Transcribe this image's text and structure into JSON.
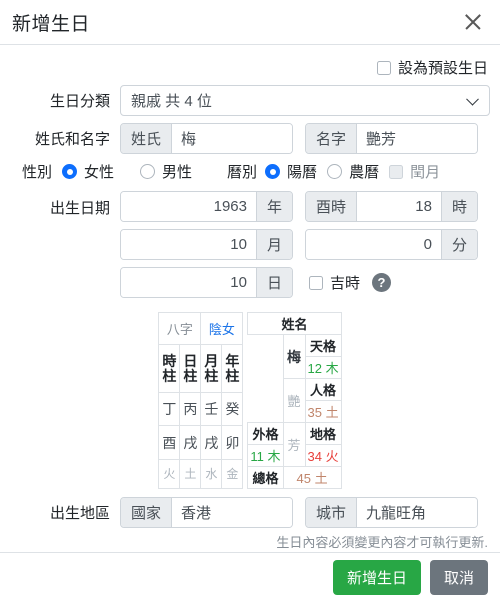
{
  "header": {
    "title": "新增生日",
    "close_icon": "close-icon"
  },
  "form": {
    "default_birthday_checkbox": {
      "label": "設為預設生日",
      "checked": false
    },
    "category": {
      "label": "生日分類",
      "value": "親戚 共 4 位",
      "chevron_icon": "chevron-down-icon"
    },
    "name": {
      "label": "姓氏和名字",
      "surname_addon": "姓氏",
      "surname_value": "梅",
      "given_addon": "名字",
      "given_value": "艷芳"
    },
    "gender": {
      "label": "性別",
      "options": [
        {
          "label": "女性",
          "selected": true
        },
        {
          "label": "男性",
          "selected": false
        }
      ]
    },
    "calendar": {
      "label": "曆別",
      "options": [
        {
          "label": "陽曆",
          "selected": true
        },
        {
          "label": "農曆",
          "selected": false
        }
      ],
      "leap_month": {
        "label": "閏月",
        "checked": false,
        "disabled": true
      }
    },
    "birthdate": {
      "label": "出生日期",
      "year": {
        "value": "1963",
        "suffix": "年"
      },
      "month": {
        "value": "10",
        "suffix": "月"
      },
      "day": {
        "value": "10",
        "suffix": "日"
      },
      "hour": {
        "prefix": "酉時",
        "value": "18",
        "suffix": "時"
      },
      "minute": {
        "value": "0",
        "suffix": "分"
      },
      "auspicious": {
        "label": "吉時",
        "checked": false
      },
      "help_icon": "question-mark-icon"
    },
    "region": {
      "label": "出生地區",
      "country_addon": "國家",
      "country_value": "香港",
      "city_addon": "城市",
      "city_value": "九龍旺角"
    },
    "hint": "生日內容必須變更內容才可執行更新."
  },
  "bazi": {
    "title": "八字",
    "polarity": "陰女",
    "pillars": [
      "時柱",
      "日柱",
      "月柱",
      "年柱"
    ],
    "stems": [
      "丁",
      "丙",
      "壬",
      "癸"
    ],
    "branches": [
      "酉",
      "戌",
      "戌",
      "卯"
    ],
    "elements": [
      "火",
      "土",
      "水",
      "金"
    ]
  },
  "name_chart": {
    "title": "姓名",
    "surname_char": "梅",
    "given_chars": [
      "艷",
      "芳"
    ],
    "grids": [
      {
        "name": "天格",
        "value": "12 木",
        "color": "#28a745"
      },
      {
        "name": "人格",
        "value": "35 土",
        "color": "#c0856b"
      },
      {
        "name": "地格",
        "value": "34 火",
        "color": "#e8413c"
      }
    ],
    "outer": {
      "name": "外格",
      "value": "11 木",
      "color": "#28a745"
    },
    "total": {
      "name": "總格",
      "value": "45 土",
      "color": "#c0856b"
    }
  },
  "footer": {
    "submit_label": "新增生日",
    "cancel_label": "取消",
    "submit_color": "#28a745",
    "cancel_color": "#6c757d"
  }
}
